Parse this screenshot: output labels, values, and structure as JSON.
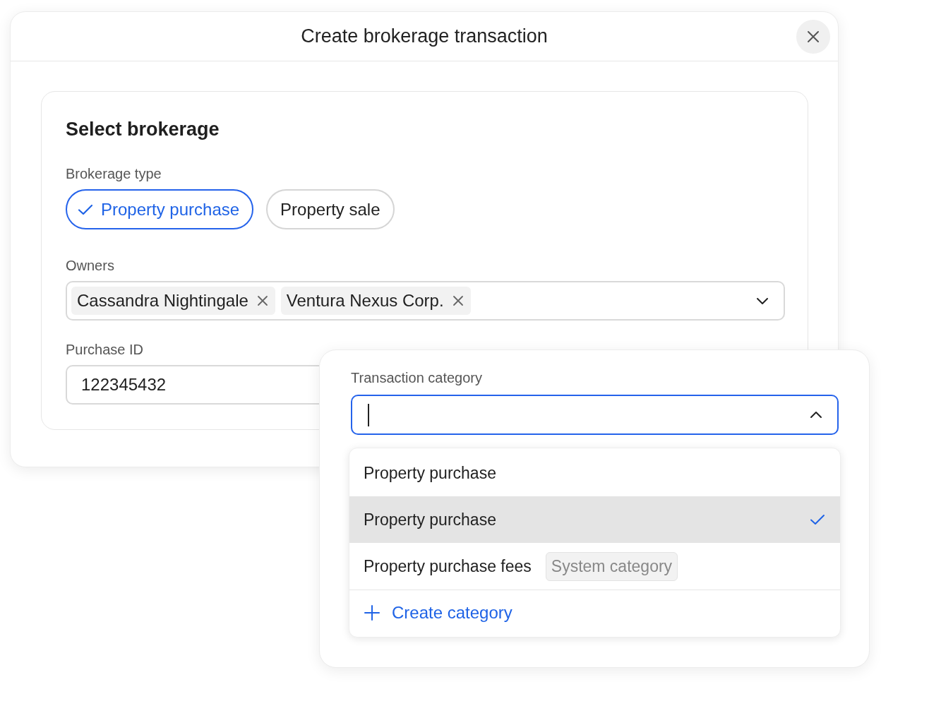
{
  "dialog": {
    "title": "Create brokerage transaction"
  },
  "section": {
    "title": "Select brokerage"
  },
  "brokerage_type": {
    "label": "Brokerage type",
    "options": [
      {
        "label": "Property purchase",
        "selected": true
      },
      {
        "label": "Property sale",
        "selected": false
      }
    ]
  },
  "owners": {
    "label": "Owners",
    "tags": [
      "Cassandra Nightingale",
      "Ventura Nexus Corp."
    ]
  },
  "purchase_id": {
    "label": "Purchase ID",
    "value": "122345432"
  },
  "transaction_category": {
    "label": "Transaction category",
    "focused": true,
    "options": [
      {
        "label": "Property purchase",
        "selected": false
      },
      {
        "label": "Property purchase",
        "selected": true
      },
      {
        "label": "Property purchase fees",
        "badge": "System category",
        "selected": false
      }
    ],
    "create_action": "Create category"
  }
}
